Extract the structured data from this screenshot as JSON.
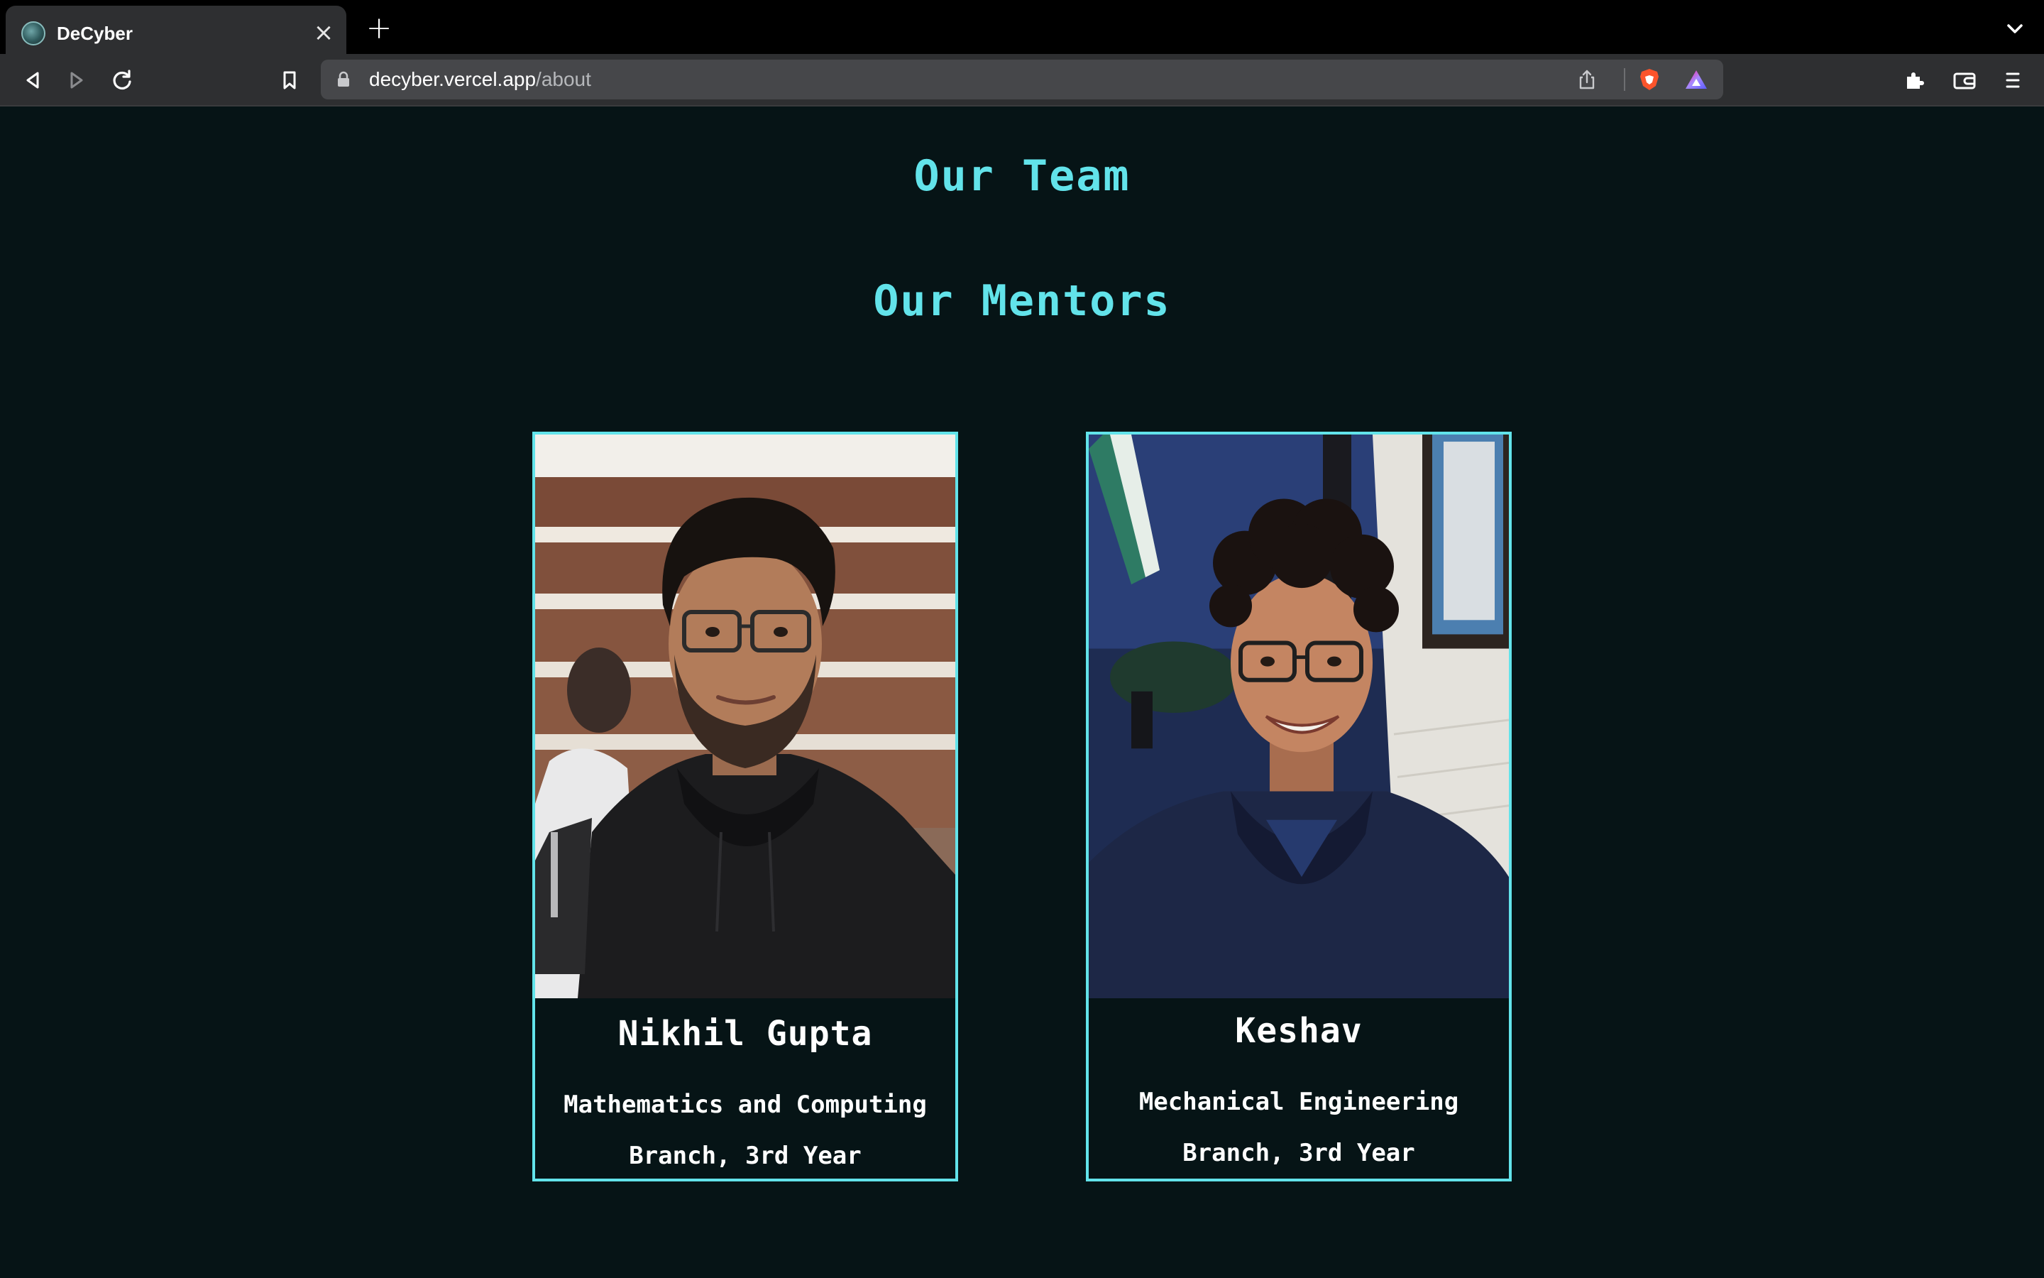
{
  "browser": {
    "tab_title": "DeCyber",
    "url_host": "decyber.vercel.app",
    "url_path": "/about"
  },
  "page": {
    "team_heading": "Our Team",
    "mentors_heading": "Our Mentors",
    "accent_color": "#62e3ea",
    "background_color": "#061416",
    "mentors": [
      {
        "name": "Nikhil Gupta",
        "branch_line1": "Mathematics and Computing",
        "branch_line2": "Branch, 3rd Year"
      },
      {
        "name": "Keshav",
        "branch_line1": "Mechanical Engineering",
        "branch_line2": "Branch, 3rd Year"
      }
    ]
  }
}
